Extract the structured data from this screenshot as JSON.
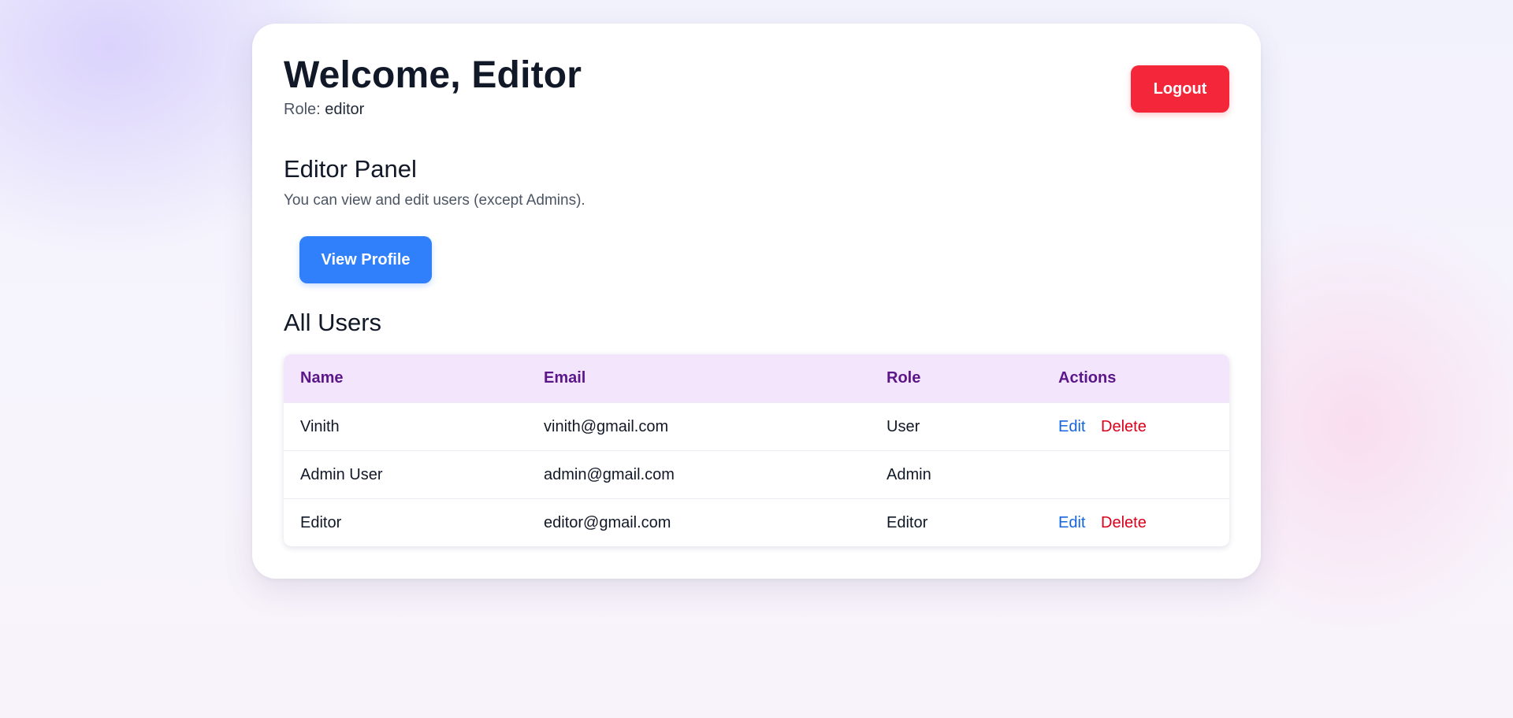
{
  "header": {
    "title": "Welcome, Editor",
    "role_label": "Role:",
    "role_value": "editor",
    "logout_label": "Logout"
  },
  "panel": {
    "title": "Editor Panel",
    "description": "You can view and edit users (except Admins).",
    "view_profile_label": "View Profile"
  },
  "users": {
    "title": "All Users",
    "columns": [
      "Name",
      "Email",
      "Role",
      "Actions"
    ],
    "rows": [
      {
        "name": "Vinith",
        "email": "vinith@gmail.com",
        "role": "User",
        "actions": [
          "Edit",
          "Delete"
        ]
      },
      {
        "name": "Admin User",
        "email": "admin@gmail.com",
        "role": "Admin",
        "actions": []
      },
      {
        "name": "Editor",
        "email": "editor@gmail.com",
        "role": "Editor",
        "actions": [
          "Edit",
          "Delete"
        ]
      }
    ]
  },
  "colors": {
    "logout": "#f4263a",
    "primary": "#2f80fa",
    "table_header_bg": "#f3e6fc",
    "table_header_text": "#5b168a",
    "edit_link": "#1565e0",
    "delete_link": "#d9001b"
  }
}
